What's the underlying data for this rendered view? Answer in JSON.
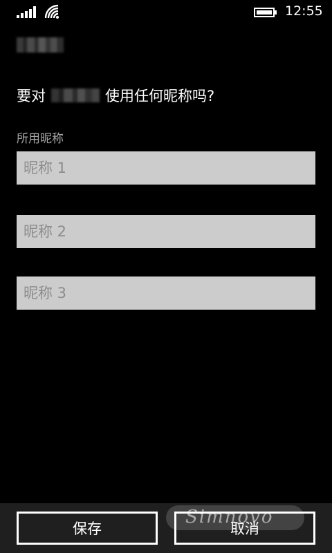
{
  "status_bar": {
    "time": "12:55",
    "icons": {
      "signal": "signal-bars-icon",
      "wifi": "wifi-icon",
      "battery": "battery-icon"
    }
  },
  "contact": {
    "name_redacted": true
  },
  "question": {
    "prefix": "要对",
    "suffix": "使用任何昵称吗?"
  },
  "nicknames": {
    "label": "所用昵称",
    "fields": [
      {
        "placeholder": "昵称 1",
        "value": ""
      },
      {
        "placeholder": "昵称 2",
        "value": ""
      },
      {
        "placeholder": "昵称 3",
        "value": ""
      }
    ]
  },
  "app_bar": {
    "save_label": "保存",
    "cancel_label": "取消"
  },
  "watermark": {
    "text": "Simnovo"
  },
  "colors": {
    "background": "#000000",
    "field_background": "#cccccc",
    "label": "#a6a6a6",
    "app_bar": "#1f1f1f"
  }
}
